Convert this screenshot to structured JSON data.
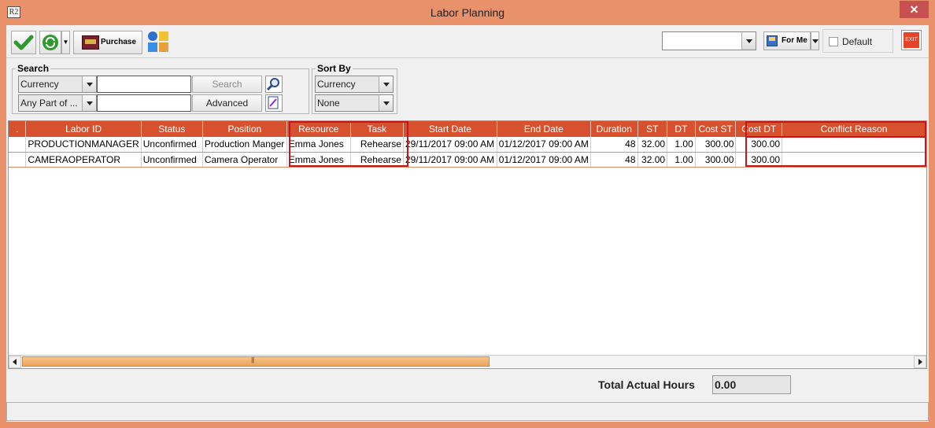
{
  "window": {
    "title": "Labor Planning",
    "app_icon_text": "R2",
    "close_label": "✕"
  },
  "toolbar": {
    "purchase_label": "Purchase",
    "layout_combo_value": "",
    "for_me_label": "For Me",
    "default_label": "Default",
    "exit_label": "EXIT"
  },
  "search": {
    "title": "Search",
    "field1_combo": "Currency",
    "field1_value": "",
    "field2_combo": "Any Part of ...",
    "field2_value": "",
    "search_button": "Search",
    "advanced_button": "Advanced"
  },
  "sort": {
    "title": "Sort By",
    "sort1": "Currency",
    "sort2": "None"
  },
  "grid": {
    "columns": [
      ".",
      "Labor ID",
      "Status",
      "Position",
      "Resource",
      "Task",
      "Start Date",
      "End Date",
      "Duration",
      "ST",
      "DT",
      "Cost ST",
      "Cost DT",
      "Conflict Reason"
    ],
    "rows": [
      {
        "marker": "",
        "labor_id": "PRODUCTIONMANAGER",
        "status": "Unconfirmed",
        "position": "Production Manger",
        "resource": "Emma Jones",
        "task": "Rehearse",
        "start": "29/11/2017 09:00 AM",
        "end": "01/12/2017 09:00 AM",
        "duration": "48",
        "st": "32.00",
        "dt": "1.00",
        "cost_st": "300.00",
        "cost_dt": "300.00",
        "conflict": ""
      },
      {
        "marker": "",
        "labor_id": "CAMERAOPERATOR",
        "status": "Unconfirmed",
        "position": "Camera Operator",
        "resource": "Emma Jones",
        "task": "Rehearse",
        "start": "29/11/2017 09:00 AM",
        "end": "01/12/2017 09:00 AM",
        "duration": "48",
        "st": "32.00",
        "dt": "1.00",
        "cost_st": "300.00",
        "cost_dt": "300.00",
        "conflict": ""
      }
    ]
  },
  "footer": {
    "total_label": "Total Actual Hours",
    "total_value": "0.00",
    "status_text": ""
  },
  "colors": {
    "window_frame": "#E9916A",
    "header_bg": "#D8512F",
    "highlight": "#C4161C"
  }
}
